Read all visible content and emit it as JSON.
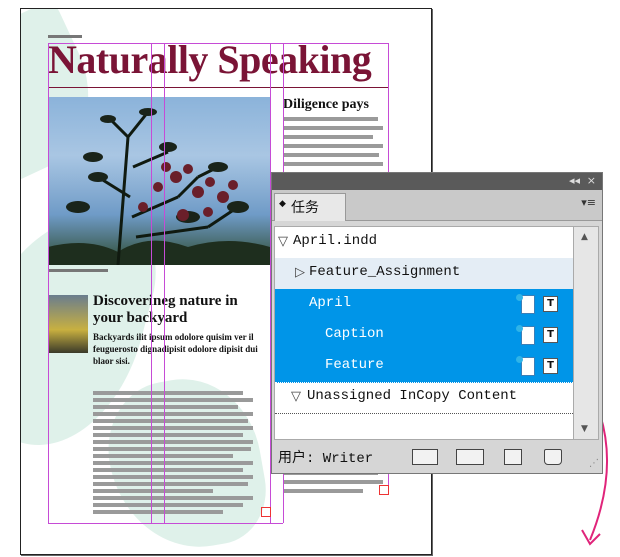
{
  "document": {
    "title": "Naturally Speaking",
    "sidebar_heading": "Diligence pays",
    "story_heading": "Discoverineg nature in your backyard",
    "story_body": "Backyards ilit ipsum odolore quisim ver il feuguerosto dignadipisit odolore dipisit dui blaor sisi."
  },
  "panel": {
    "tab_label": "任务",
    "collapse_glyph": "◂◂",
    "close_glyph": "×",
    "menu_glyph": "▾≡",
    "items": [
      {
        "label": "April.indd",
        "level": 0,
        "expanded": true,
        "selected": false
      },
      {
        "label": "Feature_Assignment",
        "level": 1,
        "expanded": false,
        "selected": false
      },
      {
        "label": "April",
        "level": 1,
        "selected": true,
        "icons": [
          "story-icon",
          "text-frame-icon"
        ]
      },
      {
        "label": "Caption",
        "level": 2,
        "selected": true,
        "icons": [
          "story-icon",
          "text-frame-icon"
        ]
      },
      {
        "label": "Feature",
        "level": 2,
        "selected": true,
        "icons": [
          "story-icon",
          "text-frame-icon"
        ]
      },
      {
        "label": "Unassigned InCopy Content",
        "level": 0,
        "expanded": true,
        "selected": false
      }
    ],
    "text_icon_glyph": "T",
    "user_label": "用户: Writer",
    "footer_icons": [
      "update-content-icon",
      "edit-assignment-icon",
      "new-assignment-icon",
      "delete-icon"
    ]
  },
  "colors": {
    "title": "#7a1436",
    "selection": "#0095e8",
    "guides": "#c64bd6",
    "arrow": "#e0247a"
  }
}
